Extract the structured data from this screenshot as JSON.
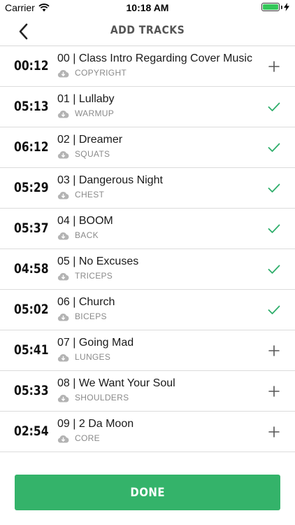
{
  "status_bar": {
    "carrier": "Carrier",
    "time": "10:18 AM"
  },
  "header": {
    "title": "ADD TRACKS",
    "back_icon": "chevron-left-icon"
  },
  "colors": {
    "accent_green": "#34b36a",
    "check_green": "#2fae6b",
    "text_gray": "#8a8a8a"
  },
  "tracks": [
    {
      "duration": "00:12",
      "title": "00 | Class Intro Regarding Cover Music",
      "category": "COPYRIGHT",
      "status": "add"
    },
    {
      "duration": "05:13",
      "title": "01 | Lullaby",
      "category": "WARMUP",
      "status": "added"
    },
    {
      "duration": "06:12",
      "title": "02 | Dreamer",
      "category": "SQUATS",
      "status": "added"
    },
    {
      "duration": "05:29",
      "title": "03 | Dangerous Night",
      "category": "CHEST",
      "status": "added"
    },
    {
      "duration": "05:37",
      "title": "04 | BOOM",
      "category": "BACK",
      "status": "added"
    },
    {
      "duration": "04:58",
      "title": "05 | No Excuses",
      "category": "TRICEPS",
      "status": "added"
    },
    {
      "duration": "05:02",
      "title": "06 | Church",
      "category": "BICEPS",
      "status": "added"
    },
    {
      "duration": "05:41",
      "title": "07 | Going Mad",
      "category": "LUNGES",
      "status": "add"
    },
    {
      "duration": "05:33",
      "title": "08 | We Want Your Soul",
      "category": "SHOULDERS",
      "status": "add"
    },
    {
      "duration": "02:54",
      "title": "09 | 2 Da Moon",
      "category": "CORE",
      "status": "add"
    }
  ],
  "footer": {
    "done_label": "DONE"
  }
}
